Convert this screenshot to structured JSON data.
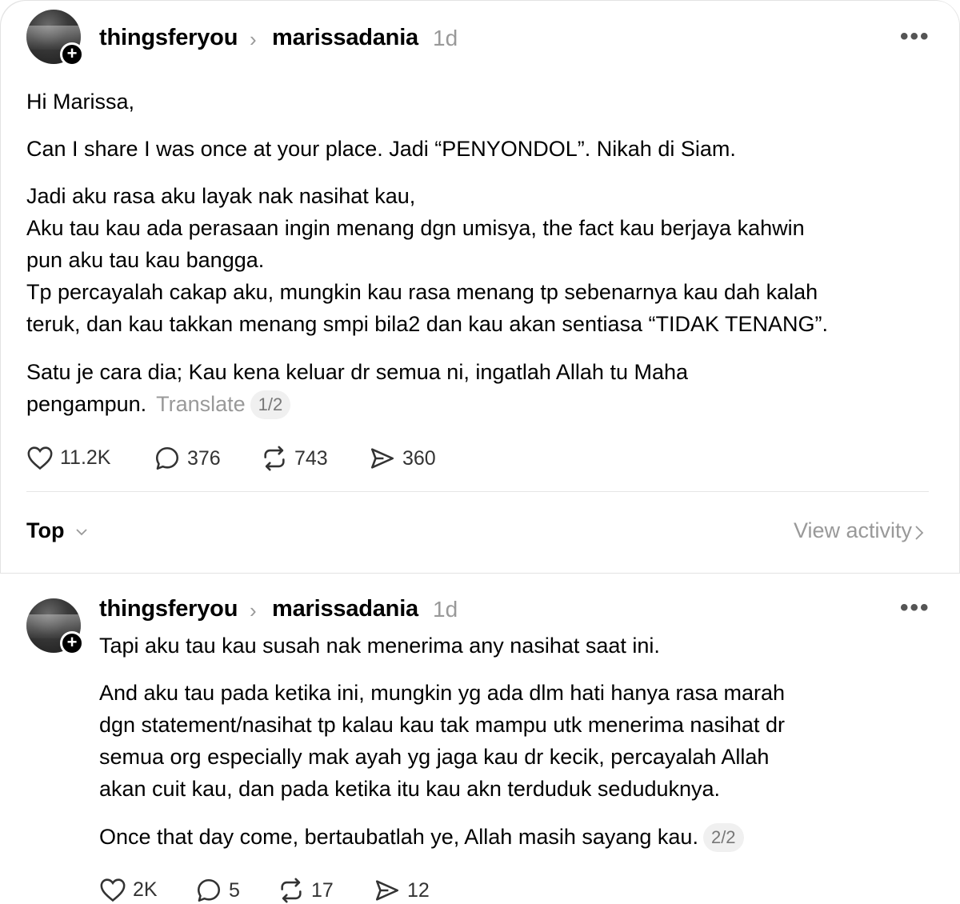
{
  "post": {
    "author": "thingsferyou",
    "reply_to": "marissadania",
    "time": "1d",
    "paragraphs": [
      "Hi Marissa,",
      "Can I share I was once at your place. Jadi “PENYONDOL”. Nikah di Siam.",
      "Jadi aku rasa aku layak nak nasihat kau,",
      "Aku tau kau ada perasaan ingin menang dgn umisya, the fact kau berjaya kahwin",
      "pun aku tau kau bangga.",
      "Tp percayalah cakap aku, mungkin kau rasa menang tp sebenarnya kau dah kalah",
      "teruk, dan kau takkan menang smpi bila2 dan kau akan sentiasa “TIDAK TENANG”.",
      "Satu je cara dia; Kau kena keluar dr semua ni, ingatlah Allah tu Maha",
      "pengampun."
    ],
    "translate": "Translate",
    "page": "1/2",
    "likes": "11.2K",
    "replies": "376",
    "reposts": "743",
    "shares": "360"
  },
  "sort": {
    "label": "Top",
    "view_activity": "View activity"
  },
  "reply": {
    "author": "thingsferyou",
    "reply_to": "marissadania",
    "time": "1d",
    "paragraphs": [
      "Tapi aku tau kau susah nak menerima any nasihat saat ini.",
      "And aku tau pada ketika ini, mungkin yg ada dlm hati hanya rasa marah",
      "dgn statement/nasihat tp kalau kau tak mampu utk menerima nasihat dr",
      "semua org especially mak ayah yg jaga kau dr kecik, percayalah Allah",
      "akan cuit kau, dan pada ketika itu kau akn terduduk seduduknya.",
      "Once that day come, bertaubatlah ye, Allah masih sayang kau."
    ],
    "page": "2/2",
    "likes": "2K",
    "replies": "5",
    "reposts": "17",
    "shares": "12"
  },
  "icons": [
    "plus-icon",
    "chevron-right-icon",
    "more-icon",
    "heart-icon",
    "comment-icon",
    "repost-icon",
    "share-icon",
    "chevron-down-icon"
  ]
}
